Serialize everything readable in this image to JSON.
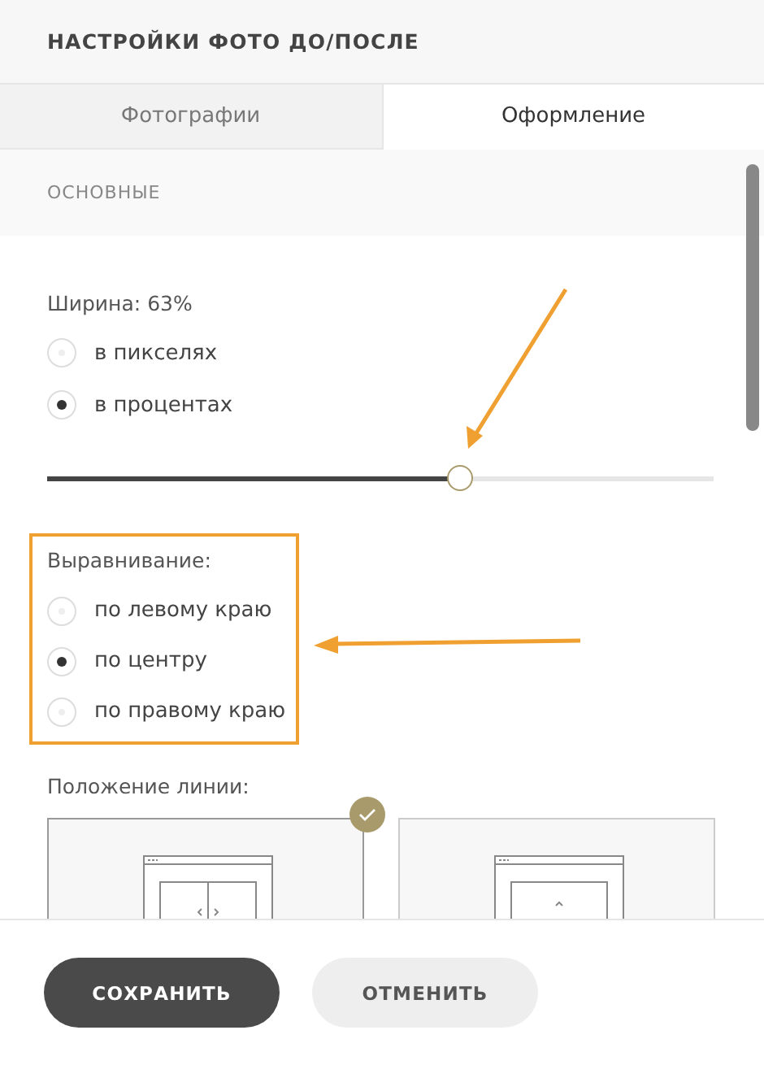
{
  "title": "НАСТРОЙКИ ФОТО ДО/ПОСЛЕ",
  "tabs": [
    {
      "label": "Фотографии",
      "selected": false
    },
    {
      "label": "Оформление",
      "selected": true
    }
  ],
  "section": "ОСНОВНЫЕ",
  "width": {
    "label": "Ширина: 63%",
    "units": [
      {
        "label": "в пикселях",
        "selected": false
      },
      {
        "label": "в процентах",
        "selected": true
      }
    ],
    "level": 0.62
  },
  "alignment": {
    "label": "Выравнивание:",
    "options": [
      {
        "label": "по левому краю",
        "selected": false
      },
      {
        "label": "по центру",
        "selected": true
      },
      {
        "label": "по правому краю",
        "selected": false
      }
    ]
  },
  "line_position": {
    "label": "Положение линии:",
    "options": [
      {
        "kind": "vertical",
        "selected": true
      },
      {
        "kind": "horizontal",
        "selected": false
      }
    ]
  },
  "buttons": [
    {
      "label": "СОХРАНИТЬ",
      "kind": "primary"
    },
    {
      "label": "ОТМЕНИТЬ",
      "kind": "secondary"
    }
  ]
}
